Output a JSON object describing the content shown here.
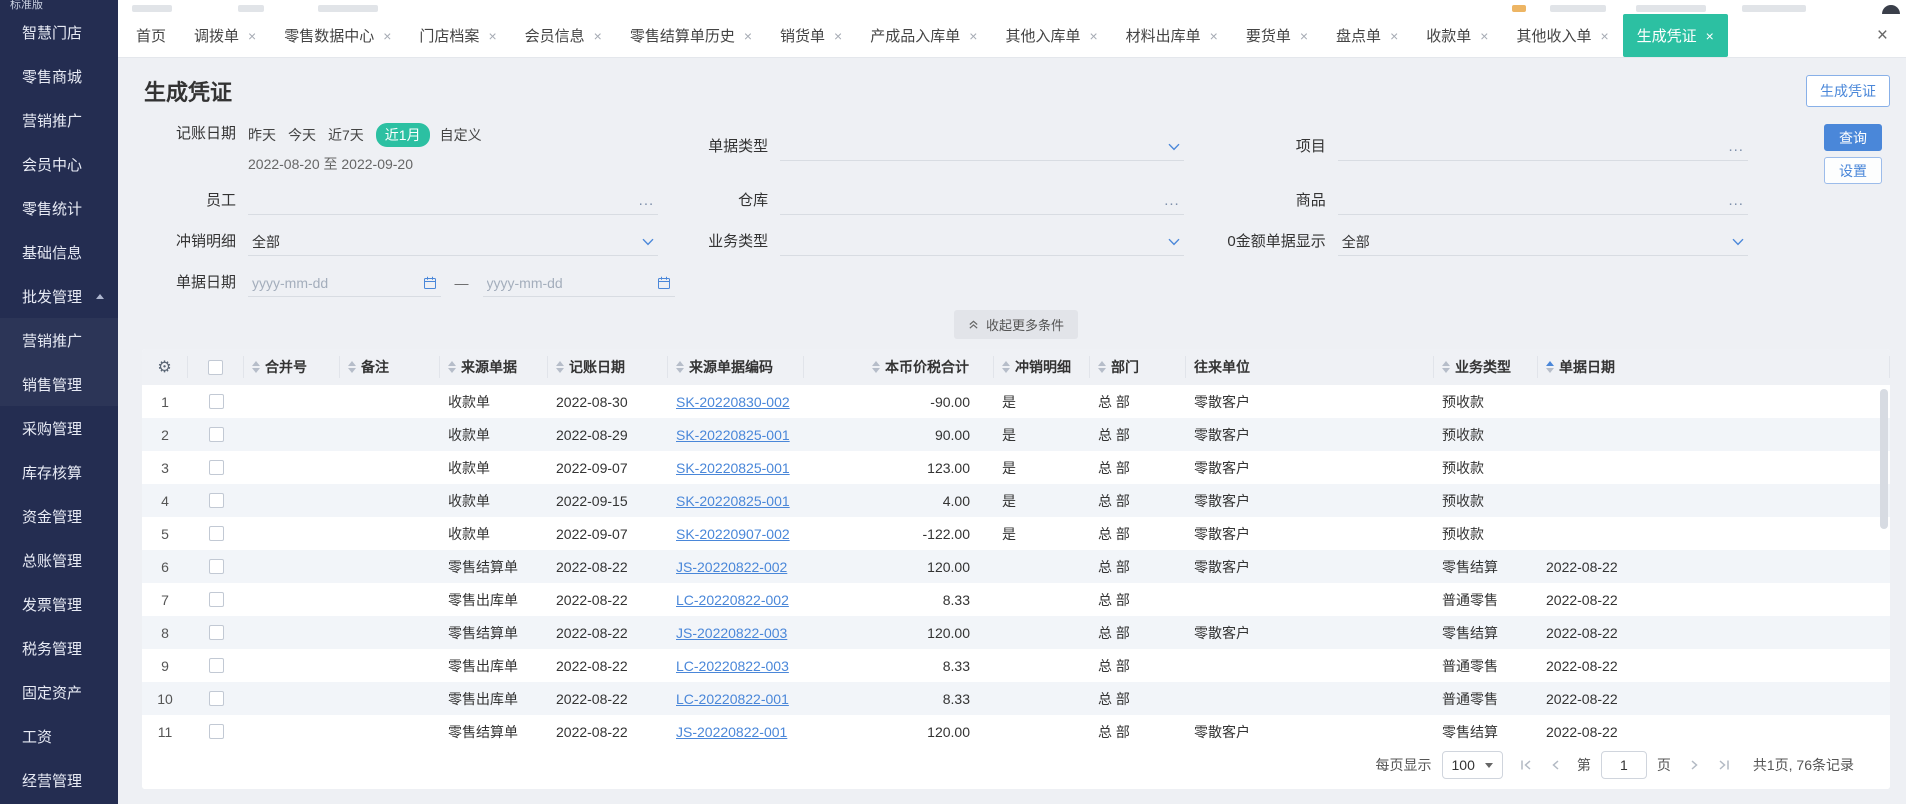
{
  "colors": {
    "sidebar_bg": "#242d51",
    "active_teal": "#2cc0a2",
    "accent_blue": "#4a87d9"
  },
  "sidebar": {
    "edition": "标准版",
    "items": [
      {
        "label": "智慧门店"
      },
      {
        "label": "零售商城"
      },
      {
        "label": "营销推广"
      },
      {
        "label": "会员中心"
      },
      {
        "label": "零售统计"
      },
      {
        "label": "基础信息"
      },
      {
        "label": "批发管理",
        "expanded": true
      },
      {
        "label": "营销推广",
        "child": true
      },
      {
        "label": "销售管理",
        "child": true
      },
      {
        "label": "采购管理"
      },
      {
        "label": "库存核算"
      },
      {
        "label": "资金管理"
      },
      {
        "label": "总账管理"
      },
      {
        "label": "发票管理"
      },
      {
        "label": "税务管理"
      },
      {
        "label": "固定资产"
      },
      {
        "label": "工资"
      },
      {
        "label": "经营管理"
      }
    ]
  },
  "tabbar": {
    "tabs": [
      {
        "label": "首页",
        "closable": false
      },
      {
        "label": "调拨单",
        "closable": true
      },
      {
        "label": "零售数据中心",
        "closable": true
      },
      {
        "label": "门店档案",
        "closable": true
      },
      {
        "label": "会员信息",
        "closable": true
      },
      {
        "label": "零售结算单历史",
        "closable": true
      },
      {
        "label": "销货单",
        "closable": true
      },
      {
        "label": "产成品入库单",
        "closable": true
      },
      {
        "label": "其他入库单",
        "closable": true
      },
      {
        "label": "材料出库单",
        "closable": true
      },
      {
        "label": "要货单",
        "closable": true
      },
      {
        "label": "盘点单",
        "closable": true
      },
      {
        "label": "收款单",
        "closable": true
      },
      {
        "label": "其他收入单",
        "closable": true
      },
      {
        "label": "生成凭证",
        "closable": true,
        "active": true
      }
    ],
    "close_all_label": "×"
  },
  "page": {
    "title": "生成凭证",
    "generate_button": "生成凭证"
  },
  "filters": {
    "booking_date": {
      "label": "记账日期",
      "quick_options": [
        {
          "label": "昨天"
        },
        {
          "label": "今天"
        },
        {
          "label": "近7天"
        },
        {
          "label": "近1月",
          "selected": true
        },
        {
          "label": "自定义"
        }
      ],
      "range_text": "2022-08-20 至 2022-09-20"
    },
    "doc_type": {
      "label": "单据类型",
      "value": ""
    },
    "project": {
      "label": "项目",
      "value": ""
    },
    "employee": {
      "label": "员工",
      "value": ""
    },
    "warehouse": {
      "label": "仓库",
      "value": ""
    },
    "goods": {
      "label": "商品",
      "value": ""
    },
    "writeoff_detail": {
      "label": "冲销明细",
      "value": "全部"
    },
    "business_type": {
      "label": "业务类型",
      "value": ""
    },
    "zero_amount_display": {
      "label": "0金额单据显示",
      "value": "全部"
    },
    "doc_date": {
      "label": "单据日期",
      "start_placeholder": "yyyy-mm-dd",
      "end_placeholder": "yyyy-mm-dd",
      "separator": "—"
    },
    "collapse_label": "收起更多条件",
    "query_button": "查询",
    "settings_button": "设置"
  },
  "table": {
    "gear_icon": "⚙",
    "columns": [
      {
        "key": "merge",
        "label": "合并号",
        "sortable": true
      },
      {
        "key": "remark",
        "label": "备注",
        "sortable": true
      },
      {
        "key": "srcdoc",
        "label": "来源单据",
        "sortable": true
      },
      {
        "key": "bkdate",
        "label": "记账日期",
        "sortable": true
      },
      {
        "key": "code",
        "label": "来源单据编码",
        "sortable": true
      },
      {
        "key": "amount",
        "label": "本币价税合计",
        "sortable": true
      },
      {
        "key": "wo",
        "label": "冲销明细",
        "sortable": true
      },
      {
        "key": "dept",
        "label": "部门",
        "sortable": true
      },
      {
        "key": "partner",
        "label": "往来单位",
        "sortable": false
      },
      {
        "key": "biz",
        "label": "业务类型",
        "sortable": true
      },
      {
        "key": "docdate",
        "label": "单据日期",
        "sortable": true,
        "sorted_asc": true
      }
    ],
    "rows": [
      {
        "num": "1",
        "merge_no": "",
        "remark": "",
        "source_doc": "收款单",
        "booking_date": "2022-08-30",
        "source_code": "SK-20220830-002",
        "amount": "-90.00",
        "writeoff": "是",
        "dept": "总 部",
        "partner": "零散客户",
        "biz_type": "预收款",
        "doc_date": ""
      },
      {
        "num": "2",
        "merge_no": "",
        "remark": "",
        "source_doc": "收款单",
        "booking_date": "2022-08-29",
        "source_code": "SK-20220825-001",
        "amount": "90.00",
        "writeoff": "是",
        "dept": "总 部",
        "partner": "零散客户",
        "biz_type": "预收款",
        "doc_date": ""
      },
      {
        "num": "3",
        "merge_no": "",
        "remark": "",
        "source_doc": "收款单",
        "booking_date": "2022-09-07",
        "source_code": "SK-20220825-001",
        "amount": "123.00",
        "writeoff": "是",
        "dept": "总 部",
        "partner": "零散客户",
        "biz_type": "预收款",
        "doc_date": ""
      },
      {
        "num": "4",
        "merge_no": "",
        "remark": "",
        "source_doc": "收款单",
        "booking_date": "2022-09-15",
        "source_code": "SK-20220825-001",
        "amount": "4.00",
        "writeoff": "是",
        "dept": "总 部",
        "partner": "零散客户",
        "biz_type": "预收款",
        "doc_date": ""
      },
      {
        "num": "5",
        "merge_no": "",
        "remark": "",
        "source_doc": "收款单",
        "booking_date": "2022-09-07",
        "source_code": "SK-20220907-002",
        "amount": "-122.00",
        "writeoff": "是",
        "dept": "总 部",
        "partner": "零散客户",
        "biz_type": "预收款",
        "doc_date": ""
      },
      {
        "num": "6",
        "merge_no": "",
        "remark": "",
        "source_doc": "零售结算单",
        "booking_date": "2022-08-22",
        "source_code": "JS-20220822-002",
        "amount": "120.00",
        "writeoff": "",
        "dept": "总 部",
        "partner": "零散客户",
        "biz_type": "零售结算",
        "doc_date": "2022-08-22"
      },
      {
        "num": "7",
        "merge_no": "",
        "remark": "",
        "source_doc": "零售出库单",
        "booking_date": "2022-08-22",
        "source_code": "LC-20220822-002",
        "amount": "8.33",
        "writeoff": "",
        "dept": "总 部",
        "partner": "",
        "biz_type": "普通零售",
        "doc_date": "2022-08-22"
      },
      {
        "num": "8",
        "merge_no": "",
        "remark": "",
        "source_doc": "零售结算单",
        "booking_date": "2022-08-22",
        "source_code": "JS-20220822-003",
        "amount": "120.00",
        "writeoff": "",
        "dept": "总 部",
        "partner": "零散客户",
        "biz_type": "零售结算",
        "doc_date": "2022-08-22"
      },
      {
        "num": "9",
        "merge_no": "",
        "remark": "",
        "source_doc": "零售出库单",
        "booking_date": "2022-08-22",
        "source_code": "LC-20220822-003",
        "amount": "8.33",
        "writeoff": "",
        "dept": "总 部",
        "partner": "",
        "biz_type": "普通零售",
        "doc_date": "2022-08-22"
      },
      {
        "num": "10",
        "merge_no": "",
        "remark": "",
        "source_doc": "零售出库单",
        "booking_date": "2022-08-22",
        "source_code": "LC-20220822-001",
        "amount": "8.33",
        "writeoff": "",
        "dept": "总 部",
        "partner": "",
        "biz_type": "普通零售",
        "doc_date": "2022-08-22"
      },
      {
        "num": "11",
        "merge_no": "",
        "remark": "",
        "source_doc": "零售结算单",
        "booking_date": "2022-08-22",
        "source_code": "JS-20220822-001",
        "amount": "120.00",
        "writeoff": "",
        "dept": "总 部",
        "partner": "零散客户",
        "biz_type": "零售结算",
        "doc_date": "2022-08-22"
      }
    ]
  },
  "pagination": {
    "per_page_label": "每页显示",
    "per_page_value": "100",
    "page_prefix": "第",
    "page_value": "1",
    "page_suffix": "页",
    "total_text": "共1页, 76条记录"
  }
}
